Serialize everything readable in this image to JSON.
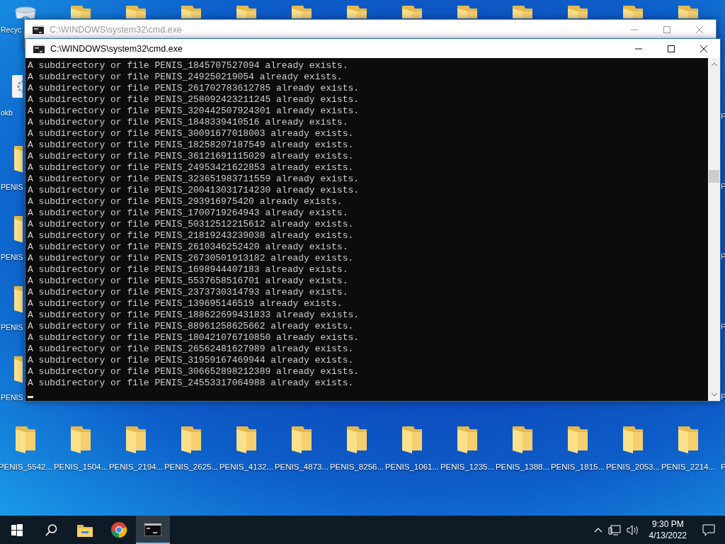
{
  "desktop": {
    "top_row": [
      {
        "kind": "folder"
      },
      {
        "kind": "folder"
      },
      {
        "kind": "folder"
      },
      {
        "kind": "folder"
      },
      {
        "kind": "folder"
      },
      {
        "kind": "folder"
      },
      {
        "kind": "folder"
      },
      {
        "kind": "folder"
      },
      {
        "kind": "folder"
      },
      {
        "kind": "folder"
      },
      {
        "kind": "folder"
      },
      {
        "kind": "folder"
      }
    ],
    "left_column": [
      {
        "kind": "recycle-bin",
        "label": "Recyc"
      },
      {
        "kind": "app",
        "label": "okb"
      },
      {
        "kind": "folder",
        "label": "PENIS"
      },
      {
        "kind": "folder",
        "label": "PENIS"
      },
      {
        "kind": "folder",
        "label": "PENIS"
      },
      {
        "kind": "folder",
        "label": "PENIS"
      }
    ],
    "right_column": [
      {
        "label": "P"
      },
      {
        "label": "P"
      },
      {
        "label": "P"
      },
      {
        "label": "P"
      },
      {
        "label": "P"
      }
    ],
    "bottom_row": [
      {
        "kind": "folder",
        "label": "PENIS_5542..."
      },
      {
        "kind": "folder",
        "label": "PENIS_1504..."
      },
      {
        "kind": "folder",
        "label": "PENIS_2194..."
      },
      {
        "kind": "folder",
        "label": "PENIS_2625..."
      },
      {
        "kind": "folder",
        "label": "PENIS_4132..."
      },
      {
        "kind": "folder",
        "label": "PENIS_4873..."
      },
      {
        "kind": "folder",
        "label": "PENIS_8256..."
      },
      {
        "kind": "folder",
        "label": "PENIS_1061..."
      },
      {
        "kind": "folder",
        "label": "PENIS_1235..."
      },
      {
        "kind": "folder",
        "label": "PENIS_1388..."
      },
      {
        "kind": "folder",
        "label": "PENIS_1815..."
      },
      {
        "kind": "folder",
        "label": "PENIS_2053..."
      },
      {
        "kind": "folder",
        "label": "PENIS_2214..."
      },
      {
        "label": "P"
      }
    ]
  },
  "windows": [
    {
      "title": "C:\\WINDOWS\\system32\\cmd.exe",
      "active": false
    },
    {
      "title": "C:\\WINDOWS\\system32\\cmd.exe",
      "active": true,
      "lines": [
        "A subdirectory or file PENIS_1845707527094 already exists.",
        "A subdirectory or file PENIS_249250219054 already exists.",
        "A subdirectory or file PENIS_261702783612785 already exists.",
        "A subdirectory or file PENIS_258092423211245 already exists.",
        "A subdirectory or file PENIS_320442507924301 already exists.",
        "A subdirectory or file PENIS_1848339410516 already exists.",
        "A subdirectory or file PENIS_30091677018003 already exists.",
        "A subdirectory or file PENIS_18258207187549 already exists.",
        "A subdirectory or file PENIS_36121691115029 already exists.",
        "A subdirectory or file PENIS_24953421622853 already exists.",
        "A subdirectory or file PENIS_323651983711559 already exists.",
        "A subdirectory or file PENIS_200413031714230 already exists.",
        "A subdirectory or file PENIS_293916975420 already exists.",
        "A subdirectory or file PENIS_1700719264943 already exists.",
        "A subdirectory or file PENIS_50312512215612 already exists.",
        "A subdirectory or file PENIS_21819243239038 already exists.",
        "A subdirectory or file PENIS_2610346252420 already exists.",
        "A subdirectory or file PENIS_26730501913182 already exists.",
        "A subdirectory or file PENIS_1698944407183 already exists.",
        "A subdirectory or file PENIS_5537658516701 already exists.",
        "A subdirectory or file PENIS_2373730314793 already exists.",
        "A subdirectory or file PENIS_139695146519 already exists.",
        "A subdirectory or file PENIS_188622699431833 already exists.",
        "A subdirectory or file PENIS_88961258625662 already exists.",
        "A subdirectory or file PENIS_180421076710850 already exists.",
        "A subdirectory or file PENIS_26562481627989 already exists.",
        "A subdirectory or file PENIS_31959167469944 already exists.",
        "A subdirectory or file PENIS_306652898212389 already exists.",
        "A subdirectory or file PENIS_24553317064988 already exists."
      ]
    }
  ],
  "taskbar": {
    "apps": [
      {
        "kind": "start",
        "selected": false
      },
      {
        "kind": "search",
        "selected": false
      },
      {
        "kind": "explorer",
        "selected": false
      },
      {
        "kind": "chrome",
        "selected": false
      },
      {
        "kind": "terminal",
        "selected": true
      }
    ],
    "time": "9:30 PM",
    "date": "4/13/2022"
  }
}
